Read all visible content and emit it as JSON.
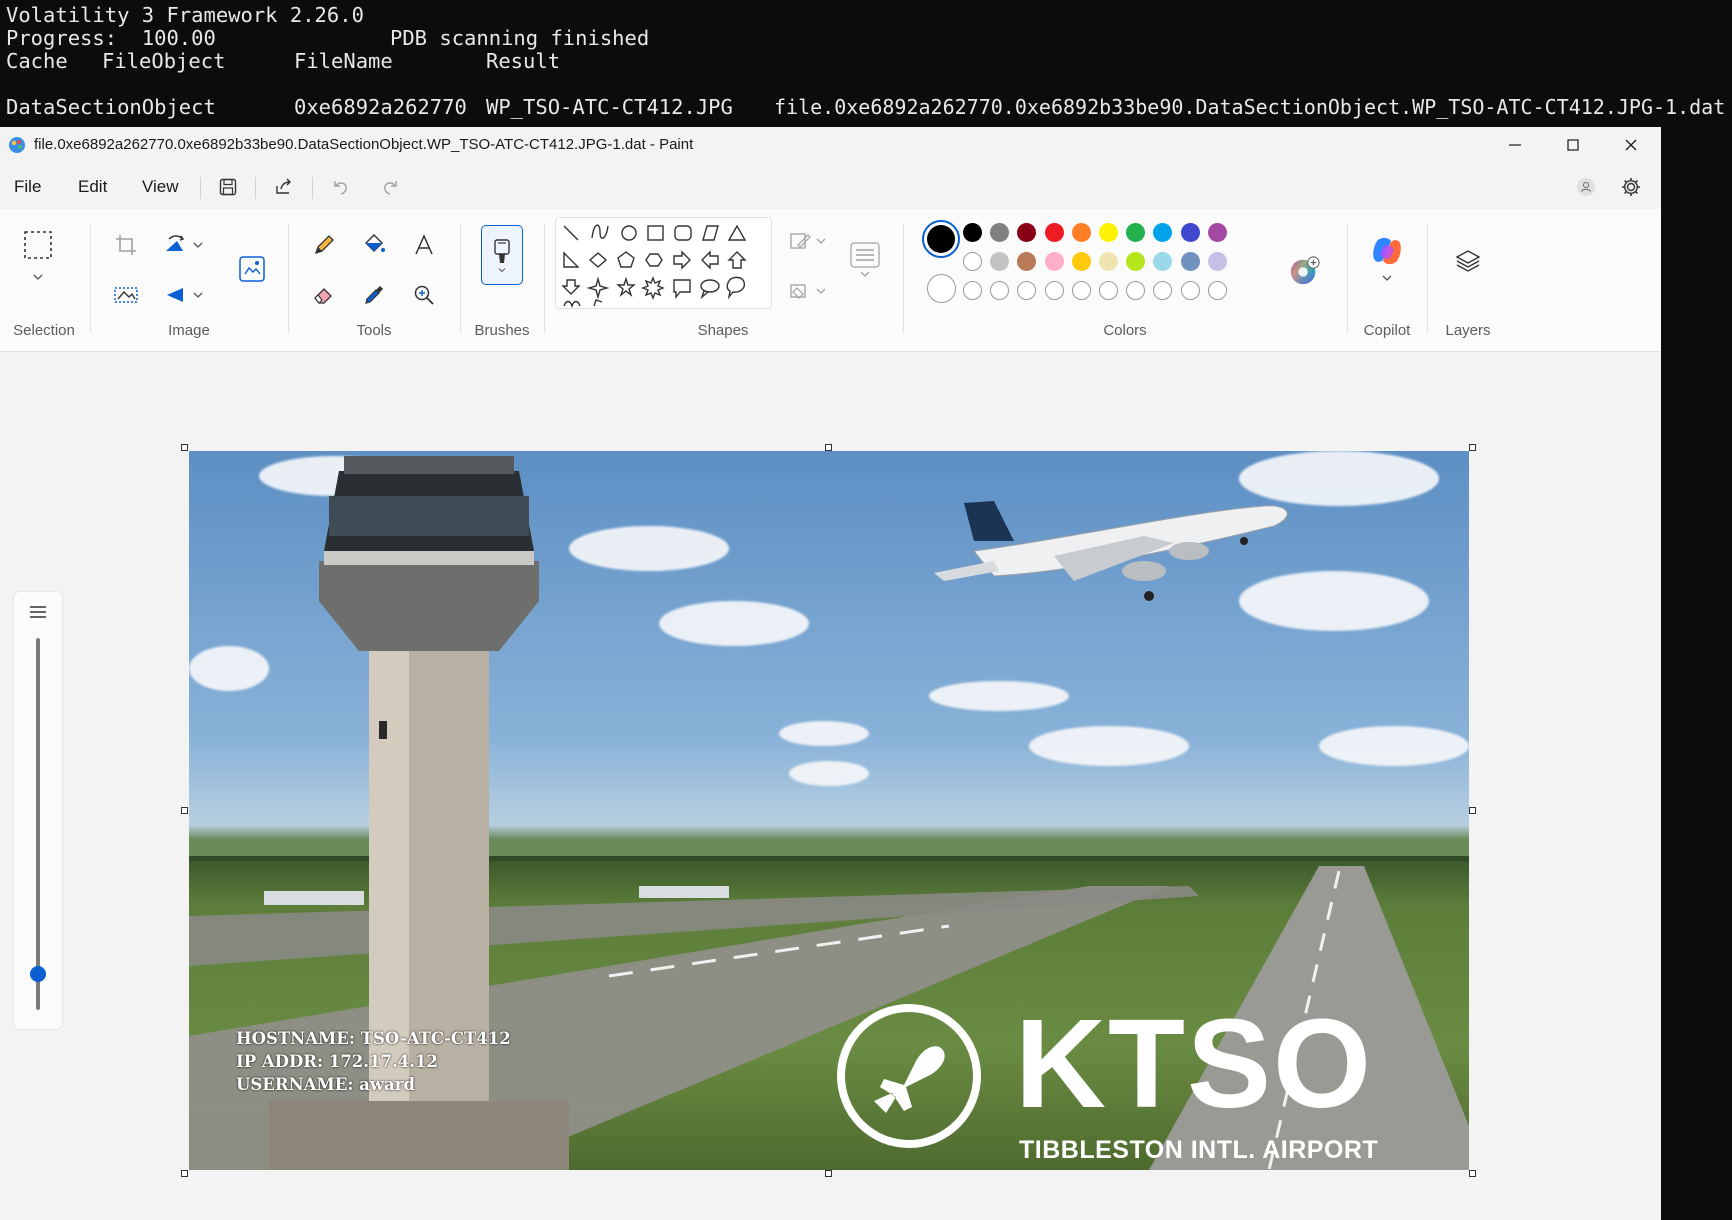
{
  "terminal": {
    "line1": "Volatility 3 Framework 2.26.0",
    "progress_label": "Progress:  100.00",
    "progress_status": "PDB scanning finished",
    "headers": [
      "Cache",
      "FileObject",
      "FileName",
      "Result"
    ],
    "row": {
      "cache": "DataSectionObject",
      "file_object": "0xe6892a262770",
      "file_name": "WP_TSO-ATC-CT412.JPG",
      "result": "file.0xe6892a262770.0xe6892b33be90.DataSectionObject.WP_TSO-ATC-CT412.JPG-1.dat"
    }
  },
  "paint": {
    "title": "file.0xe6892a262770.0xe6892b33be90.DataSectionObject.WP_TSO-ATC-CT412.JPG-1.dat - Paint",
    "menu": [
      "File",
      "Edit",
      "View"
    ],
    "groups": {
      "selection": "Selection",
      "image": "Image",
      "tools": "Tools",
      "brushes": "Brushes",
      "shapes": "Shapes",
      "colors": "Colors",
      "copilot": "Copilot",
      "layers": "Layers"
    },
    "primary_color": "#000000",
    "secondary_color": "#ffffff",
    "palette_row1": [
      "#000000",
      "#7f7f7f",
      "#880015",
      "#ed1c24",
      "#ff7f27",
      "#fff200",
      "#22b14c",
      "#00a2e8",
      "#3f48cc",
      "#a349a4"
    ],
    "palette_row2": [
      "#ffffff",
      "#c3c3c3",
      "#b97a57",
      "#ffaec9",
      "#ffc90e",
      "#efe4b0",
      "#b5e61d",
      "#99d9ea",
      "#7092be",
      "#c8bfe7"
    ]
  },
  "image": {
    "overlay_lines": [
      "HOSTNAME: TSO-ATC-CT412",
      "IP ADDR: 172.17.4.12",
      "USERNAME: award"
    ],
    "brand_code": "KTSO",
    "brand_name": "TIBBLESTON INTL. AIRPORT"
  }
}
